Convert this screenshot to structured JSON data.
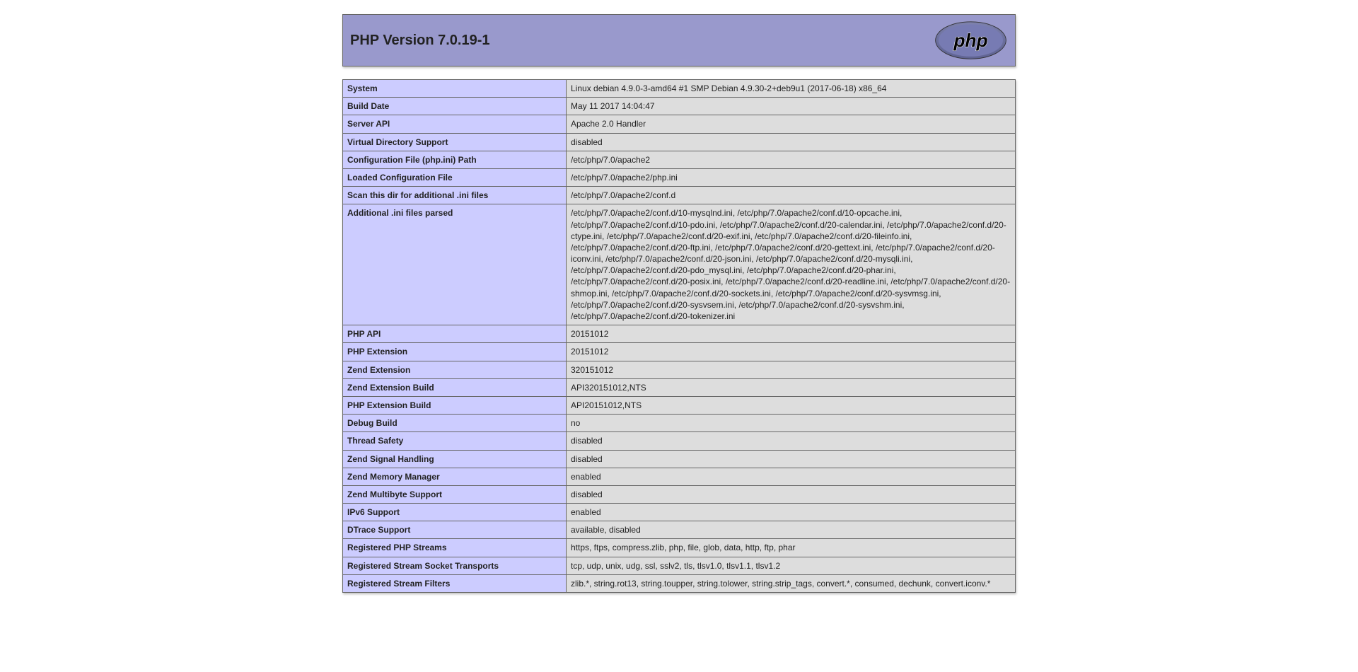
{
  "header": {
    "title": "PHP Version 7.0.19-1"
  },
  "rows": [
    {
      "label": "System",
      "value": "Linux debian 4.9.0-3-amd64 #1 SMP Debian 4.9.30-2+deb9u1 (2017-06-18) x86_64"
    },
    {
      "label": "Build Date",
      "value": "May 11 2017 14:04:47"
    },
    {
      "label": "Server API",
      "value": "Apache 2.0 Handler"
    },
    {
      "label": "Virtual Directory Support",
      "value": "disabled"
    },
    {
      "label": "Configuration File (php.ini) Path",
      "value": "/etc/php/7.0/apache2"
    },
    {
      "label": "Loaded Configuration File",
      "value": "/etc/php/7.0/apache2/php.ini"
    },
    {
      "label": "Scan this dir for additional .ini files",
      "value": "/etc/php/7.0/apache2/conf.d"
    },
    {
      "label": "Additional .ini files parsed",
      "value": "/etc/php/7.0/apache2/conf.d/10-mysqlnd.ini, /etc/php/7.0/apache2/conf.d/10-opcache.ini, /etc/php/7.0/apache2/conf.d/10-pdo.ini, /etc/php/7.0/apache2/conf.d/20-calendar.ini, /etc/php/7.0/apache2/conf.d/20-ctype.ini, /etc/php/7.0/apache2/conf.d/20-exif.ini, /etc/php/7.0/apache2/conf.d/20-fileinfo.ini, /etc/php/7.0/apache2/conf.d/20-ftp.ini, /etc/php/7.0/apache2/conf.d/20-gettext.ini, /etc/php/7.0/apache2/conf.d/20-iconv.ini, /etc/php/7.0/apache2/conf.d/20-json.ini, /etc/php/7.0/apache2/conf.d/20-mysqli.ini, /etc/php/7.0/apache2/conf.d/20-pdo_mysql.ini, /etc/php/7.0/apache2/conf.d/20-phar.ini, /etc/php/7.0/apache2/conf.d/20-posix.ini, /etc/php/7.0/apache2/conf.d/20-readline.ini, /etc/php/7.0/apache2/conf.d/20-shmop.ini, /etc/php/7.0/apache2/conf.d/20-sockets.ini, /etc/php/7.0/apache2/conf.d/20-sysvmsg.ini, /etc/php/7.0/apache2/conf.d/20-sysvsem.ini, /etc/php/7.0/apache2/conf.d/20-sysvshm.ini, /etc/php/7.0/apache2/conf.d/20-tokenizer.ini"
    },
    {
      "label": "PHP API",
      "value": "20151012"
    },
    {
      "label": "PHP Extension",
      "value": "20151012"
    },
    {
      "label": "Zend Extension",
      "value": "320151012"
    },
    {
      "label": "Zend Extension Build",
      "value": "API320151012,NTS"
    },
    {
      "label": "PHP Extension Build",
      "value": "API20151012,NTS"
    },
    {
      "label": "Debug Build",
      "value": "no"
    },
    {
      "label": "Thread Safety",
      "value": "disabled"
    },
    {
      "label": "Zend Signal Handling",
      "value": "disabled"
    },
    {
      "label": "Zend Memory Manager",
      "value": "enabled"
    },
    {
      "label": "Zend Multibyte Support",
      "value": "disabled"
    },
    {
      "label": "IPv6 Support",
      "value": "enabled"
    },
    {
      "label": "DTrace Support",
      "value": "available, disabled"
    },
    {
      "label": "Registered PHP Streams",
      "value": "https, ftps, compress.zlib, php, file, glob, data, http, ftp, phar"
    },
    {
      "label": "Registered Stream Socket Transports",
      "value": "tcp, udp, unix, udg, ssl, sslv2, tls, tlsv1.0, tlsv1.1, tlsv1.2"
    },
    {
      "label": "Registered Stream Filters",
      "value": "zlib.*, string.rot13, string.toupper, string.tolower, string.strip_tags, convert.*, consumed, dechunk, convert.iconv.*"
    }
  ]
}
